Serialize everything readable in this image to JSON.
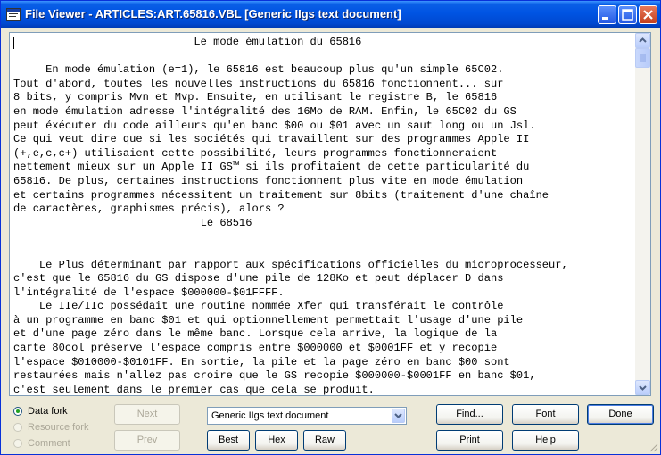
{
  "window": {
    "title": "File Viewer - ARTICLES:ART.65816.VBL [Generic IIgs text document]"
  },
  "document": {
    "lines": [
      "                            Le mode émulation du 65816",
      "",
      "     En mode émulation (e=1), le 65816 est beaucoup plus qu'un simple 65C02.",
      "Tout d'abord, toutes les nouvelles instructions du 65816 fonctionnent... sur",
      "8 bits, y compris Mvn et Mvp. Ensuite, en utilisant le registre B, le 65816",
      "en mode émulation adresse l'intégralité des 16Mo de RAM. Enfin, le 65C02 du GS",
      "peut éxécuter du code ailleurs qu'en banc $00 ou $01 avec un saut long ou un Jsl.",
      "Ce qui veut dire que si les sociétés qui travaillent sur des programmes Apple II",
      "(+,e,c,c+) utilisaient cette possibilité, leurs programmes fonctionneraient",
      "nettement mieux sur un Apple II GS™ si ils profitaient de cette particularité du",
      "65816. De plus, certaines instructions fonctionnent plus vite en mode émulation",
      "et certains programmes nécessitent un traitement sur 8bits (traitement d'une chaîne",
      "de caractères, graphismes précis), alors ?",
      "                             Le 68516",
      "",
      "",
      "    Le Plus déterminant par rapport aux spécifications officielles du microprocesseur,",
      "c'est que le 65816 du GS dispose d'une pile de 128Ko et peut déplacer D dans",
      "l'intégralité de l'espace $000000-$01FFFF.",
      "    Le IIe/IIc possédait une routine nommée Xfer qui transférait le contrôle",
      "à un programme en banc $01 et qui optionnellement permettait l'usage d'une pile",
      "et d'une page zéro dans le même banc. Lorsque cela arrive, la logique de la",
      "carte 80col préserve l'espace compris entre $000000 et $0001FF et y recopie",
      "l'espace $010000-$0101FF. En sortie, la pile et la page zéro en banc $00 sont",
      "restaurées mais n'allez pas croire que le GS recopie $000000-$0001FF en banc $01,",
      "c'est seulement dans le premier cas que cela se produit."
    ]
  },
  "fork": {
    "options": [
      {
        "label": "Data fork",
        "selected": true,
        "enabled": true
      },
      {
        "label": "Resource fork",
        "selected": false,
        "enabled": false
      },
      {
        "label": "Comment",
        "selected": false,
        "enabled": false
      }
    ]
  },
  "buttons": {
    "next": "Next",
    "prev": "Prev",
    "best": "Best",
    "hex": "Hex",
    "raw": "Raw",
    "find": "Find...",
    "font": "Font",
    "done": "Done",
    "print": "Print",
    "help": "Help"
  },
  "converter": {
    "selected": "Generic IIgs text document"
  },
  "colors": {
    "titlebar": "#0054e3",
    "close": "#c4401d",
    "face": "#ece9d8"
  }
}
